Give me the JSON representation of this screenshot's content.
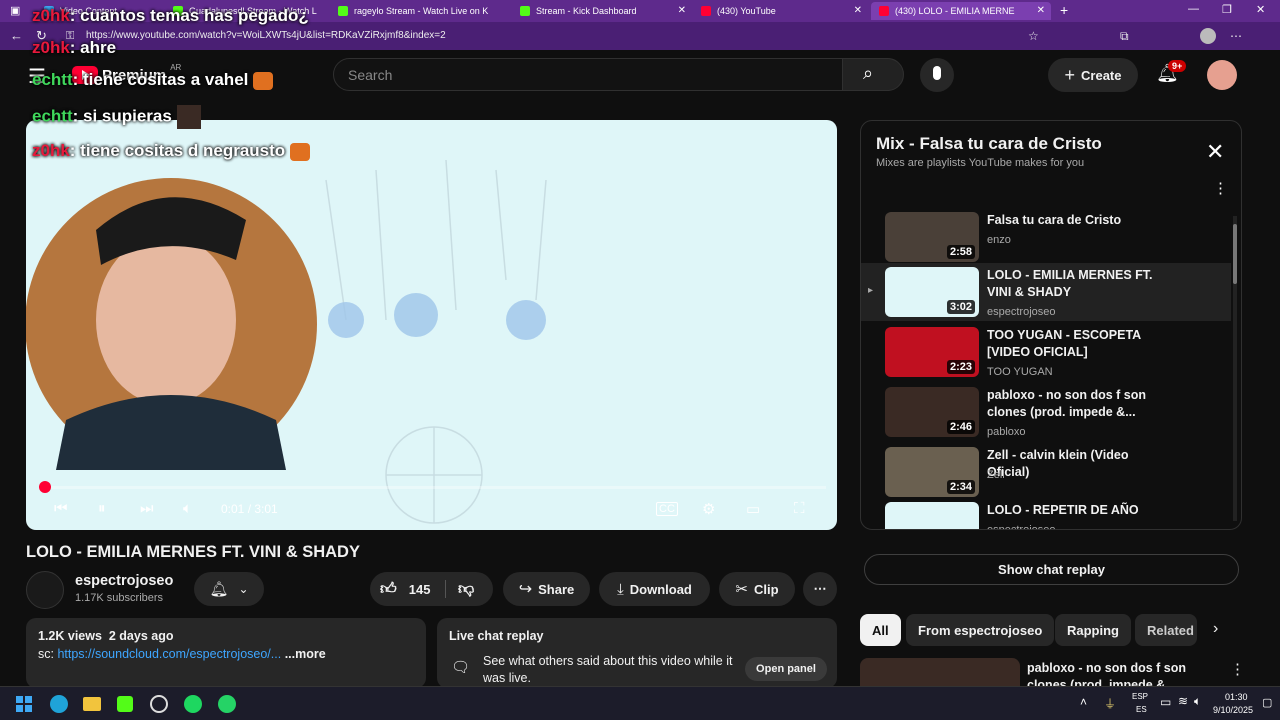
{
  "browser": {
    "tabs": [
      {
        "label": "Video Content",
        "color": "#3fa9f5"
      },
      {
        "label": "Guadalupesdl Stream - Watch L",
        "color": "#53fc18"
      },
      {
        "label": "rageylo Stream - Watch Live on K",
        "color": "#53fc18"
      },
      {
        "label": "Stream - Kick Dashboard",
        "color": "#53fc18"
      },
      {
        "label": "(430) YouTube",
        "color": "#ff0033"
      },
      {
        "label": "(430) LOLO - EMILIA MERNE",
        "color": "#ff0033"
      }
    ],
    "new_tab": "+",
    "url": "https://www.youtube.com/watch?v=WoiLXWTs4jU&list=RDKaVZiRxjmf8&index=2"
  },
  "chat_overlay": [
    {
      "user": "z0hk",
      "text": ": cuantos temas has pegado¿",
      "user_color": "#e8193c"
    },
    {
      "user": "z0hk",
      "text": ": ahre",
      "user_color": "#e8193c"
    },
    {
      "user": "echtt",
      "text": ": tiene cositas a vahel",
      "user_color": "#3fd75b"
    },
    {
      "user": "echtt",
      "text": ": si supieras",
      "user_color": "#3fd75b"
    },
    {
      "user": "z0hk",
      "text": ": tiene cositas d negrausto",
      "user_color": "#e8193c"
    }
  ],
  "masthead": {
    "logo_text": "Premium",
    "country": "AR",
    "search_placeholder": "Search",
    "create_label": "Create",
    "notif_badge": "9+"
  },
  "player": {
    "time": "0:01 / 3:01",
    "progress": 0.006
  },
  "video": {
    "title": "LOLO - EMILIA MERNES FT. VINI & SHADY",
    "channel": "espectrojoseo",
    "subscribers": "1.17K subscribers",
    "likes": "145",
    "share": "Share",
    "download": "Download",
    "clip": "Clip",
    "views_date": "1.2K views  2 days ago",
    "desc_prefix": "sc: ",
    "desc_link": "https://soundcloud.com/espectrojoseo/...",
    "more": "...more"
  },
  "live_chat": {
    "title": "Live chat replay",
    "body": "See what others said about this video while it was live.",
    "button": "Open panel"
  },
  "mix": {
    "title": "Mix - Falsa tu cara de Cristo",
    "subtitle": "Mixes are playlists YouTube makes for you",
    "items": [
      {
        "title": "Falsa tu cara de Cristo",
        "channel": "enzo",
        "duration": "2:58",
        "thumb": "#4a4038"
      },
      {
        "title": "LOLO - EMILIA MERNES FT. VINI & SHADY",
        "channel": "espectrojoseo",
        "duration": "3:02",
        "thumb": "#dff6f8",
        "playing": "▸"
      },
      {
        "title": "TOO YUGAN - ESCOPETA [VIDEO OFICIAL]",
        "channel": "TOO YUGAN",
        "duration": "2:23",
        "thumb": "#c01020"
      },
      {
        "title": "pabloxo - no son dos f son clones (prod. impede &...",
        "channel": "pabloxo",
        "duration": "2:46",
        "thumb": "#3a2a24"
      },
      {
        "title": "Zell - calvin klein (Video Oficial)",
        "channel": "Zell",
        "duration": "2:34",
        "thumb": "#6a6050"
      },
      {
        "title": "LOLO - REPETIR DE AÑO",
        "channel": "espectrojoseo",
        "duration": "",
        "thumb": "#dff6f8"
      }
    ]
  },
  "show_chat_replay": "Show chat replay",
  "chips": [
    "All",
    "From espectrojoseo",
    "Rapping",
    "Related"
  ],
  "related": {
    "title": "pabloxo - no son dos f son clones (prod. impede &..."
  },
  "taskbar": {
    "lang": "ESP",
    "lang2": "ES",
    "time": "01:30",
    "date": "9/10/2025"
  }
}
